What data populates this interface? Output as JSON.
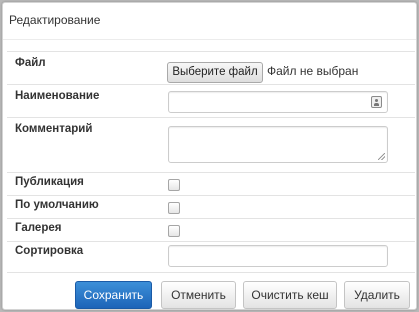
{
  "dialog": {
    "title": "Редактирование"
  },
  "form": {
    "file": {
      "label": "Файл",
      "button_label": "Выберите файл",
      "status": "Файл не выбран"
    },
    "name": {
      "label": "Наименование",
      "value": ""
    },
    "comment": {
      "label": "Комментарий",
      "value": ""
    },
    "publication": {
      "label": "Публикация",
      "checked": false
    },
    "default": {
      "label": "По умолчанию",
      "checked": false
    },
    "gallery": {
      "label": "Галерея",
      "checked": false
    },
    "sort": {
      "label": "Сортировка",
      "value": ""
    }
  },
  "footer": {
    "save_label": "Сохранить",
    "cancel_label": "Отменить",
    "clear_cache_label": "Очистить кеш",
    "delete_label": "Удалить"
  },
  "colors": {
    "primary_button": "#1d64b8",
    "background": "#b9b9b9",
    "dialog_background": "#ffffff"
  }
}
